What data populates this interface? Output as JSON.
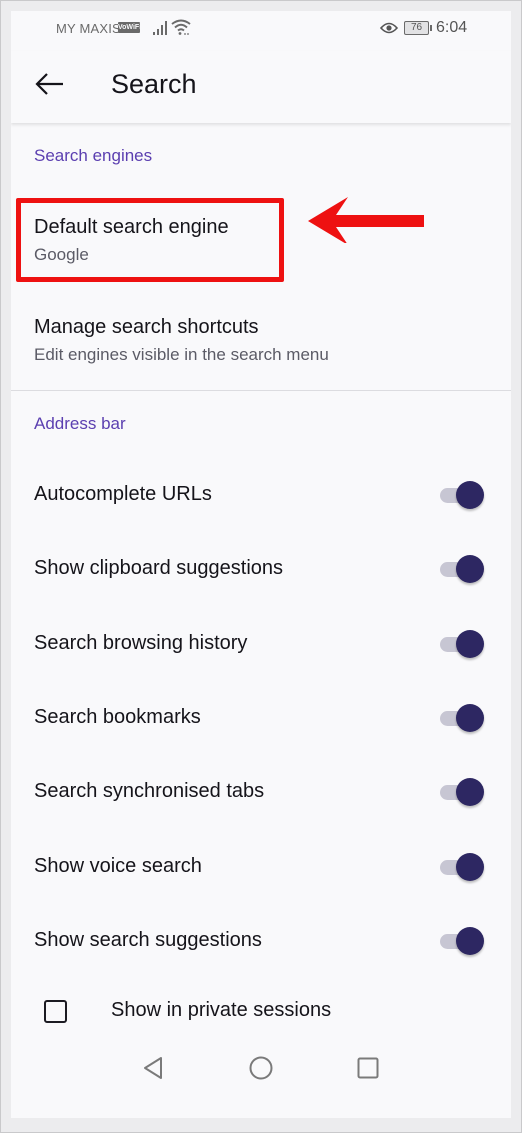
{
  "status_bar": {
    "carrier": "MY MAXIS",
    "vowifi_badge": "VoWiFi",
    "signal_icon": "signal-bars-icon",
    "wifi_icon": "wifi-icon",
    "eye_icon": "eye-comfort-icon",
    "battery_level": "76",
    "time": "6:04"
  },
  "toolbar": {
    "back_icon": "arrow-left-icon",
    "title": "Search"
  },
  "sections": {
    "search_engines": {
      "header": "Search engines",
      "items": [
        {
          "title": "Default search engine",
          "summary": "Google"
        },
        {
          "title": "Manage search shortcuts",
          "summary": "Edit engines visible in the search menu"
        }
      ]
    },
    "address_bar": {
      "header": "Address bar",
      "switches": [
        {
          "label": "Autocomplete URLs",
          "checked": true
        },
        {
          "label": "Show clipboard suggestions",
          "checked": true
        },
        {
          "label": "Search browsing history",
          "checked": true
        },
        {
          "label": "Search bookmarks",
          "checked": true
        },
        {
          "label": "Search synchronised tabs",
          "checked": true
        },
        {
          "label": "Show voice search",
          "checked": true
        },
        {
          "label": "Show search suggestions",
          "checked": true
        }
      ],
      "checkbox": {
        "label": "Show in private sessions",
        "checked": false
      }
    }
  },
  "annotation": {
    "highlight_color": "#ee1111",
    "arrow_direction": "left"
  },
  "colors": {
    "accent": "#5b3fb0",
    "switch_thumb": "#2d2762",
    "switch_track": "#c7c6d3",
    "background": "#f9f9fb"
  },
  "navigation_bar": {
    "back": "nav-back-icon",
    "home": "nav-home-icon",
    "recents": "nav-recents-icon"
  }
}
